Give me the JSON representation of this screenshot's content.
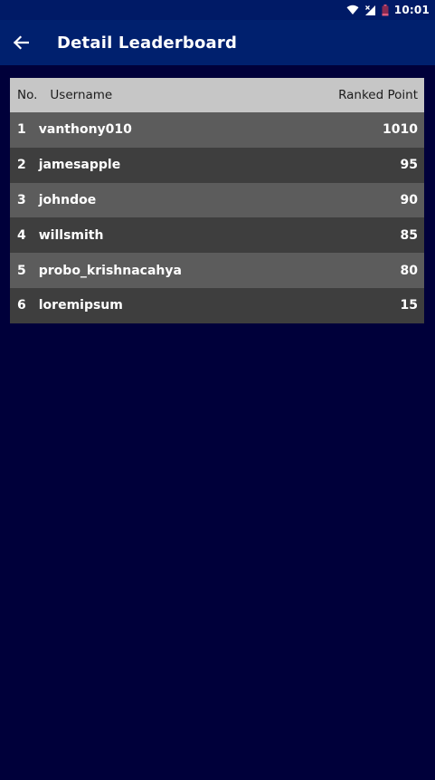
{
  "status_bar": {
    "time": "10:01"
  },
  "app_bar": {
    "title": "Detail Leaderboard",
    "back_icon": "arrow-left-icon"
  },
  "table": {
    "headers": {
      "no": "No.",
      "username": "Username",
      "points": "Ranked Point"
    },
    "rows": [
      {
        "rank": "1",
        "username": "vanthony010",
        "points": "1010"
      },
      {
        "rank": "2",
        "username": "jamesapple",
        "points": "95"
      },
      {
        "rank": "3",
        "username": "johndoe",
        "points": "90"
      },
      {
        "rank": "4",
        "username": "willsmith",
        "points": "85"
      },
      {
        "rank": "5",
        "username": "probo_krishnacahya",
        "points": "80"
      },
      {
        "rank": "6",
        "username": "loremipsum",
        "points": "15"
      }
    ]
  },
  "colors": {
    "background": "#00003a",
    "app_bar": "#00206e",
    "header_row": "#c6c6c6",
    "row_light": "#5c5c5c",
    "row_dark": "#3e3e3e"
  }
}
